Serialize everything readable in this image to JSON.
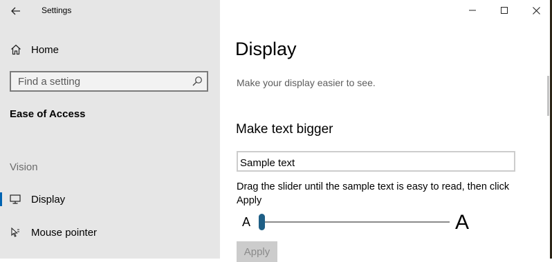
{
  "window": {
    "app_title": "Settings",
    "controls": {
      "minimize": "minimize-icon",
      "maximize": "maximize-icon",
      "close": "close-icon"
    }
  },
  "sidebar": {
    "home_label": "Home",
    "search": {
      "placeholder": "Find a setting",
      "value": ""
    },
    "section_title": "Ease of Access",
    "group_label": "Vision",
    "items": [
      {
        "label": "Display",
        "icon": "monitor-icon",
        "active": true
      },
      {
        "label": "Mouse pointer",
        "icon": "mouse-pointer-icon",
        "active": false
      }
    ]
  },
  "main": {
    "title": "Display",
    "description": "Make your display easier to see.",
    "text_size": {
      "heading": "Make text bigger",
      "sample_text": "Sample text",
      "instruction": "Drag the slider until the sample text is easy to read, then click Apply",
      "min_label": "A",
      "max_label": "A",
      "slider_value_percent": 0,
      "apply_label": "Apply",
      "apply_enabled": false
    }
  },
  "colors": {
    "sidebar_bg": "#e6e6e6",
    "accent": "#0063b1",
    "slider_thumb": "#1f5f86",
    "disabled_button": "#cccccc"
  }
}
